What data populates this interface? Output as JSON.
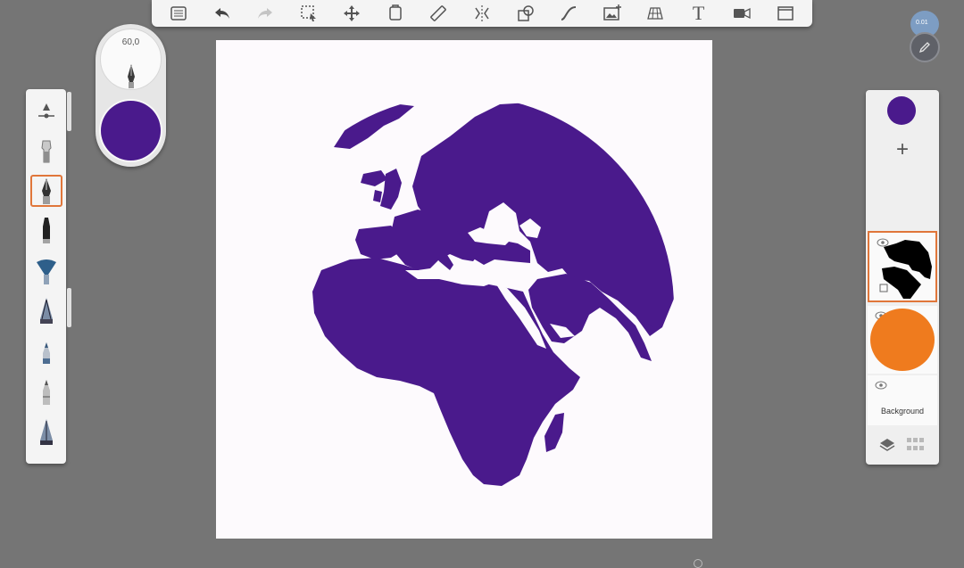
{
  "toolbar": {
    "icons": [
      "list-icon",
      "undo-icon",
      "redo-icon",
      "selection-icon",
      "move-icon",
      "stencil-icon",
      "ruler-icon",
      "symmetry-icon",
      "shapes-icon",
      "curve-icon",
      "image-import-icon",
      "perspective-grid-icon",
      "text-icon",
      "video-icon",
      "fullscreen-icon"
    ],
    "text_glyph": "T"
  },
  "brush": {
    "size_value": "60,0",
    "color": "#4a1a8c"
  },
  "tools": {
    "items": [
      "opacity-slider-icon",
      "smudge-tool-icon",
      "pen-tool-icon",
      "marker-tool-icon",
      "airbrush-tool-icon",
      "paintbrush-tool-icon",
      "pencil-tool-icon",
      "ballpoint-tool-icon",
      "chisel-tool-icon"
    ],
    "selected": "pen-tool-icon"
  },
  "layers": {
    "current_color": "#4a1a8c",
    "add_label": "+",
    "items": [
      {
        "name": "globe-layer",
        "selected": true
      },
      {
        "name": "orange-circle-layer",
        "color": "#ef7b1e"
      },
      {
        "name": "background-layer",
        "label": "Background"
      }
    ]
  },
  "status_badge": "0.01",
  "artwork": {
    "globe_color": "#4a1a8c",
    "canvas_color": "#fdfafd"
  }
}
